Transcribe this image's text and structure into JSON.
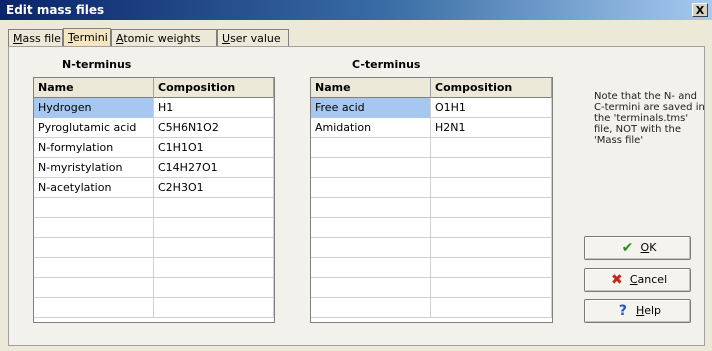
{
  "window": {
    "title": "Edit mass files",
    "close_label": "X"
  },
  "tabs": [
    {
      "label": "Mass file",
      "mnemonic": "M",
      "rest": "ass file"
    },
    {
      "label": "Termini",
      "mnemonic": "T",
      "rest": "ermini",
      "active": true
    },
    {
      "label": "Atomic weights",
      "mnemonic": "A",
      "rest": "tomic weights"
    },
    {
      "label": "User value",
      "mnemonic": "U",
      "rest": "ser value"
    }
  ],
  "n_terminus": {
    "group_label": "N-terminus",
    "columns": [
      "Name",
      "Composition"
    ],
    "rows": [
      [
        "Hydrogen",
        "H1"
      ],
      [
        "Pyroglutamic acid",
        "C5H6N1O2"
      ],
      [
        "N-formylation",
        "C1H1O1"
      ],
      [
        "N-myristylation",
        "C14H27O1"
      ],
      [
        "N-acetylation",
        "C2H3O1"
      ],
      [
        "",
        ""
      ],
      [
        "",
        ""
      ],
      [
        "",
        ""
      ],
      [
        "",
        ""
      ],
      [
        "",
        ""
      ],
      [
        "",
        ""
      ]
    ]
  },
  "c_terminus": {
    "group_label": "C-terminus",
    "columns": [
      "Name",
      "Composition"
    ],
    "rows": [
      [
        "Free acid",
        "O1H1"
      ],
      [
        "Amidation",
        "H2N1"
      ],
      [
        "",
        ""
      ],
      [
        "",
        ""
      ],
      [
        "",
        ""
      ],
      [
        "",
        ""
      ],
      [
        "",
        ""
      ],
      [
        "",
        ""
      ],
      [
        "",
        ""
      ],
      [
        "",
        ""
      ],
      [
        "",
        ""
      ]
    ]
  },
  "note": "Note that the N- and C-termini are saved in the 'terminals.tms' file, NOT with the 'Mass file'",
  "buttons": {
    "ok": {
      "mnemonic": "O",
      "rest": "K",
      "icon": "checkmark-icon"
    },
    "cancel": {
      "mnemonic": "C",
      "rest": "ancel",
      "icon": "x-icon"
    },
    "help": {
      "mnemonic": "H",
      "rest": "elp",
      "icon": "question-icon"
    }
  },
  "colors": {
    "selection": "#A6C8F0",
    "active_tab": "#F3E6C0",
    "title_start": "#0A246A"
  }
}
